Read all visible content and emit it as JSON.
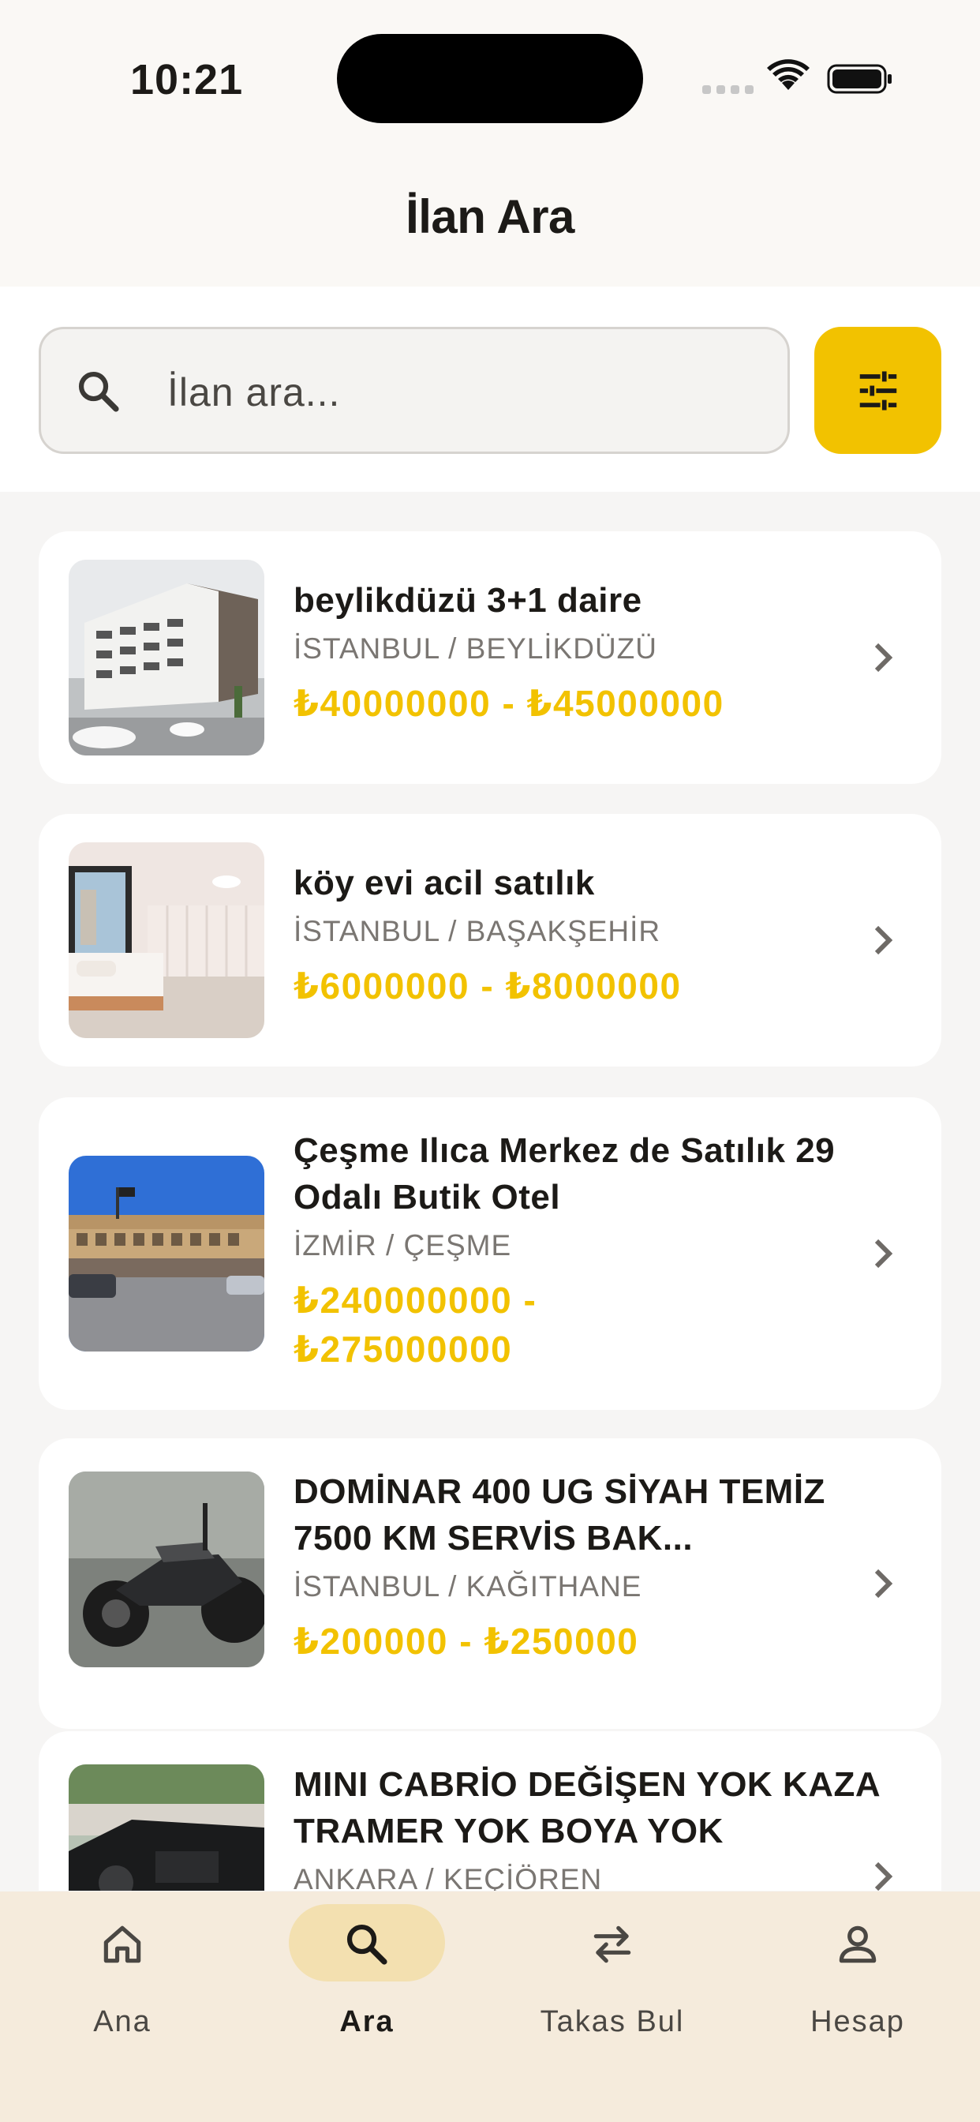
{
  "status_bar": {
    "time": "10:21"
  },
  "header": {
    "title": "İlan Ara"
  },
  "search": {
    "placeholder": "İlan ara..."
  },
  "listings": [
    {
      "title": "beylikdüzü 3+1 daire",
      "location": "İSTANBUL / BEYLİKDÜZÜ",
      "price": "₺40000000 - ₺45000000",
      "image": "apartment-building-photo"
    },
    {
      "title": "köy evi acil satılık",
      "location": "İSTANBUL / BAŞAKŞEHİR",
      "price": "₺6000000 - ₺8000000",
      "image": "bedroom-interior-photo"
    },
    {
      "title": "Çeşme Ilıca Merkez de Satılık 29 Odalı Butik Otel",
      "location": "İZMİR / ÇEŞME",
      "price": "₺240000000 - ₺275000000",
      "image": "hotel-street-photo"
    },
    {
      "title": "DOMİNAR 400 UG SİYAH TEMİZ 7500 KM SERVİS BAK...",
      "location": "İSTANBUL / KAĞITHANE",
      "price": "₺200000 - ₺250000",
      "image": "motorcycle-photo"
    },
    {
      "title": "MINI CABRİO DEĞİŞEN YOK KAZA TRAMER YOK BOYA YOK",
      "location": "ANKARA / KEÇİÖREN",
      "price": "",
      "image": "convertible-car-photo"
    }
  ],
  "tab_bar": {
    "tabs": [
      {
        "label": "Ana",
        "icon": "home-icon",
        "active": false
      },
      {
        "label": "Ara",
        "icon": "search-icon",
        "active": true
      },
      {
        "label": "Takas Bul",
        "icon": "swap-icon",
        "active": false
      },
      {
        "label": "Hesap",
        "icon": "person-icon",
        "active": false
      }
    ]
  },
  "colors": {
    "accent": "#f2c200",
    "active_tab_pill": "#f3e0b0",
    "tab_bar_bg": "#f5ebdc"
  }
}
